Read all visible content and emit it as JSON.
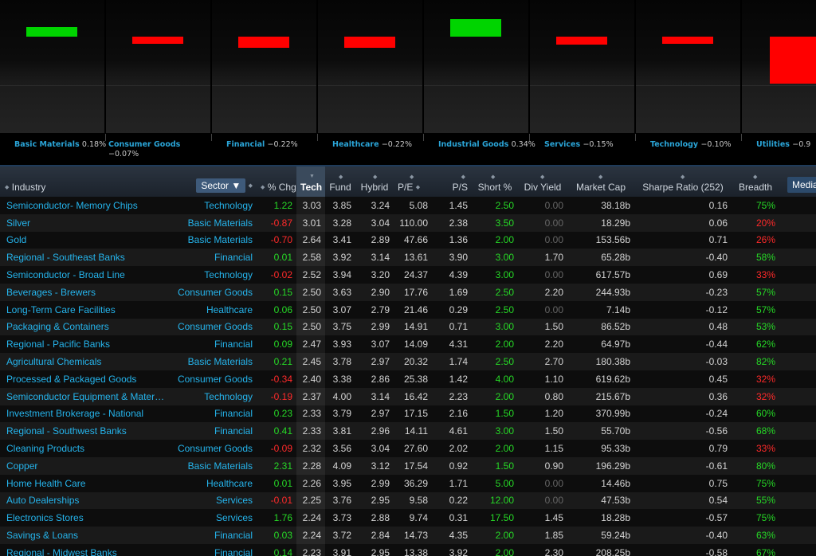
{
  "sector_chart": {
    "sectors": [
      {
        "name": "Basic Materials",
        "change": "0.18%",
        "value": 0.18
      },
      {
        "name": "Consumer Goods",
        "change": "−0.07%",
        "value": -0.07
      },
      {
        "name": "Financial",
        "change": "−0.22%",
        "value": -0.22
      },
      {
        "name": "Healthcare",
        "change": "−0.22%",
        "value": -0.22
      },
      {
        "name": "Industrial Goods",
        "change": "0.34%",
        "value": 0.34
      },
      {
        "name": "Services",
        "change": "−0.15%",
        "value": -0.15
      },
      {
        "name": "Technology",
        "change": "−0.10%",
        "value": -0.1
      },
      {
        "name": "Utilities",
        "change": "−0.9",
        "value": -0.9
      }
    ],
    "colors": {
      "positive": "#00d400",
      "negative": "#ff0000"
    }
  },
  "table": {
    "headers": {
      "industry": "Industry",
      "sector": "Sector",
      "chg": "% Chg",
      "tech": "Tech",
      "fund": "Fund",
      "hybrid": "Hybrid",
      "pe": "P/E",
      "ps": "P/S",
      "short": "Short %",
      "div": "Div Yield",
      "mcap": "Market Cap",
      "sharpe": "Sharpe Ratio (252)",
      "breadth": "Breadth",
      "median": "Median F"
    },
    "rows": [
      {
        "industry": "Semiconductor- Memory Chips",
        "sector": "Technology",
        "chg": "1.22",
        "tech": "3.03",
        "fund": "3.85",
        "hybrid": "3.24",
        "pe": "5.08",
        "ps": "1.45",
        "short": "2.50",
        "div": "0.00",
        "mcap": "38.18b",
        "sharpe": "0.16",
        "breadth": "75%"
      },
      {
        "industry": "Silver",
        "sector": "Basic Materials",
        "chg": "-0.87",
        "tech": "3.01",
        "fund": "3.28",
        "hybrid": "3.04",
        "pe": "110.00",
        "ps": "2.38",
        "short": "3.50",
        "div": "0.00",
        "mcap": "18.29b",
        "sharpe": "0.06",
        "breadth": "20%"
      },
      {
        "industry": "Gold",
        "sector": "Basic Materials",
        "chg": "-0.70",
        "tech": "2.64",
        "fund": "3.41",
        "hybrid": "2.89",
        "pe": "47.66",
        "ps": "1.36",
        "short": "2.00",
        "div": "0.00",
        "mcap": "153.56b",
        "sharpe": "0.71",
        "breadth": "26%"
      },
      {
        "industry": "Regional - Southeast Banks",
        "sector": "Financial",
        "chg": "0.01",
        "tech": "2.58",
        "fund": "3.92",
        "hybrid": "3.14",
        "pe": "13.61",
        "ps": "3.90",
        "short": "3.00",
        "div": "1.70",
        "mcap": "65.28b",
        "sharpe": "-0.40",
        "breadth": "58%"
      },
      {
        "industry": "Semiconductor - Broad Line",
        "sector": "Technology",
        "chg": "-0.02",
        "tech": "2.52",
        "fund": "3.94",
        "hybrid": "3.20",
        "pe": "24.37",
        "ps": "4.39",
        "short": "3.00",
        "div": "0.00",
        "mcap": "617.57b",
        "sharpe": "0.69",
        "breadth": "33%"
      },
      {
        "industry": "Beverages - Brewers",
        "sector": "Consumer Goods",
        "chg": "0.15",
        "tech": "2.50",
        "fund": "3.63",
        "hybrid": "2.90",
        "pe": "17.76",
        "ps": "1.69",
        "short": "2.50",
        "div": "2.20",
        "mcap": "244.93b",
        "sharpe": "-0.23",
        "breadth": "57%"
      },
      {
        "industry": "Long-Term Care Facilities",
        "sector": "Healthcare",
        "chg": "0.06",
        "tech": "2.50",
        "fund": "3.07",
        "hybrid": "2.79",
        "pe": "21.46",
        "ps": "0.29",
        "short": "2.50",
        "div": "0.00",
        "mcap": "7.14b",
        "sharpe": "-0.12",
        "breadth": "57%"
      },
      {
        "industry": "Packaging & Containers",
        "sector": "Consumer Goods",
        "chg": "0.15",
        "tech": "2.50",
        "fund": "3.75",
        "hybrid": "2.99",
        "pe": "14.91",
        "ps": "0.71",
        "short": "3.00",
        "div": "1.50",
        "mcap": "86.52b",
        "sharpe": "0.48",
        "breadth": "53%"
      },
      {
        "industry": "Regional - Pacific Banks",
        "sector": "Financial",
        "chg": "0.09",
        "tech": "2.47",
        "fund": "3.93",
        "hybrid": "3.07",
        "pe": "14.09",
        "ps": "4.31",
        "short": "2.00",
        "div": "2.20",
        "mcap": "64.97b",
        "sharpe": "-0.44",
        "breadth": "62%"
      },
      {
        "industry": "Agricultural Chemicals",
        "sector": "Basic Materials",
        "chg": "0.21",
        "tech": "2.45",
        "fund": "3.78",
        "hybrid": "2.97",
        "pe": "20.32",
        "ps": "1.74",
        "short": "2.50",
        "div": "2.70",
        "mcap": "180.38b",
        "sharpe": "-0.03",
        "breadth": "82%"
      },
      {
        "industry": "Processed & Packaged Goods",
        "sector": "Consumer Goods",
        "chg": "-0.34",
        "tech": "2.40",
        "fund": "3.38",
        "hybrid": "2.86",
        "pe": "25.38",
        "ps": "1.42",
        "short": "4.00",
        "div": "1.10",
        "mcap": "619.62b",
        "sharpe": "0.45",
        "breadth": "32%"
      },
      {
        "industry": "Semiconductor Equipment & Materi…",
        "sector": "Technology",
        "chg": "-0.19",
        "tech": "2.37",
        "fund": "4.00",
        "hybrid": "3.14",
        "pe": "16.42",
        "ps": "2.23",
        "short": "2.00",
        "div": "0.80",
        "mcap": "215.67b",
        "sharpe": "0.36",
        "breadth": "32%"
      },
      {
        "industry": "Investment Brokerage - National",
        "sector": "Financial",
        "chg": "0.23",
        "tech": "2.33",
        "fund": "3.79",
        "hybrid": "2.97",
        "pe": "17.15",
        "ps": "2.16",
        "short": "1.50",
        "div": "1.20",
        "mcap": "370.99b",
        "sharpe": "-0.24",
        "breadth": "60%"
      },
      {
        "industry": "Regional - Southwest Banks",
        "sector": "Financial",
        "chg": "0.41",
        "tech": "2.33",
        "fund": "3.81",
        "hybrid": "2.96",
        "pe": "14.11",
        "ps": "4.61",
        "short": "3.00",
        "div": "1.50",
        "mcap": "55.70b",
        "sharpe": "-0.56",
        "breadth": "68%"
      },
      {
        "industry": "Cleaning Products",
        "sector": "Consumer Goods",
        "chg": "-0.09",
        "tech": "2.32",
        "fund": "3.56",
        "hybrid": "3.04",
        "pe": "27.60",
        "ps": "2.02",
        "short": "2.00",
        "div": "1.15",
        "mcap": "95.33b",
        "sharpe": "0.79",
        "breadth": "33%"
      },
      {
        "industry": "Copper",
        "sector": "Basic Materials",
        "chg": "2.31",
        "tech": "2.28",
        "fund": "4.09",
        "hybrid": "3.12",
        "pe": "17.54",
        "ps": "0.92",
        "short": "1.50",
        "div": "0.90",
        "mcap": "196.29b",
        "sharpe": "-0.61",
        "breadth": "80%"
      },
      {
        "industry": "Home Health Care",
        "sector": "Healthcare",
        "chg": "0.01",
        "tech": "2.26",
        "fund": "3.95",
        "hybrid": "2.99",
        "pe": "36.29",
        "ps": "1.71",
        "short": "5.00",
        "div": "0.00",
        "mcap": "14.46b",
        "sharpe": "0.75",
        "breadth": "75%"
      },
      {
        "industry": "Auto Dealerships",
        "sector": "Services",
        "chg": "-0.01",
        "tech": "2.25",
        "fund": "3.76",
        "hybrid": "2.95",
        "pe": "9.58",
        "ps": "0.22",
        "short": "12.00",
        "div": "0.00",
        "mcap": "47.53b",
        "sharpe": "0.54",
        "breadth": "55%"
      },
      {
        "industry": "Electronics Stores",
        "sector": "Services",
        "chg": "1.76",
        "tech": "2.24",
        "fund": "3.73",
        "hybrid": "2.88",
        "pe": "9.74",
        "ps": "0.31",
        "short": "17.50",
        "div": "1.45",
        "mcap": "18.28b",
        "sharpe": "-0.57",
        "breadth": "75%"
      },
      {
        "industry": "Savings & Loans",
        "sector": "Financial",
        "chg": "0.03",
        "tech": "2.24",
        "fund": "3.72",
        "hybrid": "2.84",
        "pe": "14.73",
        "ps": "4.35",
        "short": "2.00",
        "div": "1.85",
        "mcap": "59.24b",
        "sharpe": "-0.40",
        "breadth": "63%"
      },
      {
        "industry": "Regional - Midwest Banks",
        "sector": "Financial",
        "chg": "0.14",
        "tech": "2.23",
        "fund": "3.91",
        "hybrid": "2.95",
        "pe": "13.38",
        "ps": "3.92",
        "short": "2.00",
        "div": "2.30",
        "mcap": "208.25b",
        "sharpe": "-0.58",
        "breadth": "67%"
      }
    ]
  }
}
